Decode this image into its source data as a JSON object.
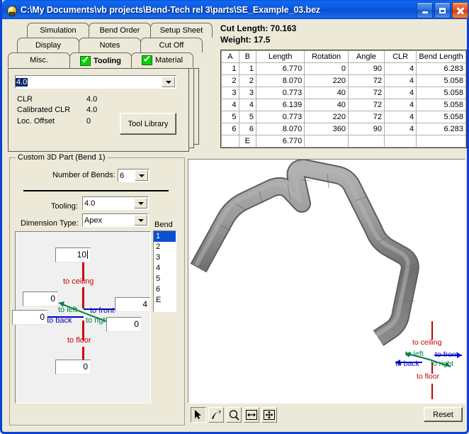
{
  "window": {
    "title": "C:\\My Documents\\vb projects\\Bend-Tech rel 3\\parts\\SE_Example_03.bez",
    "icon": "bend-tech-icon",
    "minimize": "minimize-icon",
    "maximize": "maximize-icon",
    "close": "close-icon"
  },
  "tabs": {
    "row1": [
      {
        "label": "Simulation",
        "selected": false,
        "checked": false
      },
      {
        "label": "Bend Order",
        "selected": false,
        "checked": false
      },
      {
        "label": "Setup Sheet",
        "selected": false,
        "checked": false
      }
    ],
    "row2": [
      {
        "label": "Display",
        "selected": false,
        "checked": false
      },
      {
        "label": "Notes",
        "selected": false,
        "checked": false
      },
      {
        "label": "Cut Off",
        "selected": false,
        "checked": false
      }
    ],
    "row3": [
      {
        "label": "Misc.",
        "selected": false,
        "checked": false
      },
      {
        "label": "Tooling",
        "selected": true,
        "checked": true
      },
      {
        "label": "Material",
        "selected": false,
        "checked": true
      }
    ]
  },
  "tooling_page": {
    "combo_value": "4.0",
    "rows": [
      {
        "label": "CLR",
        "value": "4.0"
      },
      {
        "label": "Calibrated CLR",
        "value": "4.0"
      },
      {
        "label": "Loc. Offset",
        "value": "0"
      }
    ],
    "tool_library_button": "Tool Library"
  },
  "summary": {
    "cut_length": "Cut Length: 70.163",
    "weight": "Weight: 17.5"
  },
  "bend_table": {
    "headers": [
      "A",
      "B",
      "Length",
      "Rotation",
      "Angle",
      "CLR",
      "Bend Length"
    ],
    "rows": [
      [
        "1",
        "1",
        "6.770",
        "0",
        "90",
        "4",
        "6.283"
      ],
      [
        "2",
        "2",
        "8.070",
        "220",
        "72",
        "4",
        "5.058"
      ],
      [
        "3",
        "3",
        "0.773",
        "40",
        "72",
        "4",
        "5.058"
      ],
      [
        "4",
        "4",
        "6.139",
        "40",
        "72",
        "4",
        "5.058"
      ],
      [
        "5",
        "5",
        "0.773",
        "220",
        "72",
        "4",
        "5.058"
      ],
      [
        "6",
        "6",
        "8.070",
        "360",
        "90",
        "4",
        "6.283"
      ],
      [
        "",
        "E",
        "6.770",
        "",
        "",
        "",
        ""
      ]
    ]
  },
  "custom_part": {
    "group_title": "Custom 3D Part (Bend 1)",
    "number_of_bends_label": "Number of Bends:",
    "number_of_bends_value": "6",
    "tooling_label": "Tooling:",
    "tooling_value": "4.0",
    "dimension_type_label": "Dimension Type:",
    "dimension_type_value": "Apex"
  },
  "bend_list": {
    "header": "Bend",
    "items": [
      "1",
      "2",
      "3",
      "4",
      "5",
      "6",
      "E"
    ],
    "selected_index": 0
  },
  "dimension_diagram": {
    "to_ceiling_label": "to ceiling",
    "to_floor_label": "to floor",
    "to_left_label": "to left",
    "to_right_label": "to right",
    "to_front_label": "to front",
    "to_back_label": "to back",
    "ceiling_value": "10",
    "floor_value": "0",
    "left_value": "0",
    "right_value": "4",
    "back_value": "0",
    "front_value": "0"
  },
  "viewport": {
    "axis": {
      "to_ceiling_label": "to ceiling",
      "to_floor_label": "to floor",
      "to_left_label": "to left",
      "to_right_label": "to right",
      "to_front_label": "to front",
      "to_back_label": "to back"
    },
    "toolbar": [
      {
        "icon": "select-arrow-icon",
        "pressed": true
      },
      {
        "icon": "rotate-icon",
        "pressed": false
      },
      {
        "icon": "zoom-magnifier-icon",
        "pressed": false
      },
      {
        "icon": "zoom-extents-icon",
        "pressed": false
      },
      {
        "icon": "pan-move-icon",
        "pressed": false
      }
    ],
    "reset_button": "Reset"
  },
  "colors": {
    "title_blue": "#0a51dd",
    "window_face": "#ece9d8",
    "select_blue": "#0a50d0",
    "check_green": "#00d400",
    "axis_red": "#cc0000",
    "axis_green": "#008040",
    "axis_blue": "#0000c0",
    "tube_gray": "#808080"
  }
}
